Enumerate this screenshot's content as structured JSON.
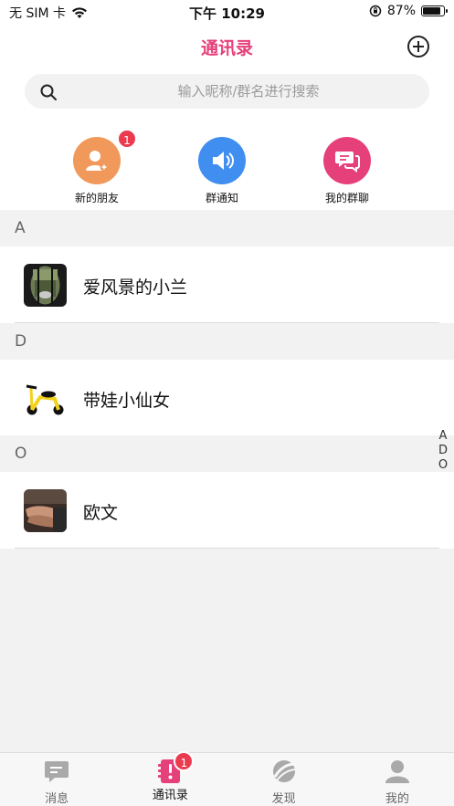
{
  "status_bar": {
    "carrier": "无 SIM 卡",
    "time": "下午 10:29",
    "battery_percent": "87%",
    "battery_level": 0.87
  },
  "header": {
    "title": "通讯录",
    "add_icon": "plus-circle-icon"
  },
  "search": {
    "placeholder": "输入昵称/群名进行搜索",
    "value": ""
  },
  "quick_actions": [
    {
      "label": "新的朋友",
      "icon": "new-friend-icon",
      "color": "#f0995a",
      "badge": "1"
    },
    {
      "label": "群通知",
      "icon": "speaker-icon",
      "color": "#3f8ef0",
      "badge": ""
    },
    {
      "label": "我的群聊",
      "icon": "group-chat-icon",
      "color": "#e6407a",
      "badge": ""
    }
  ],
  "sections": [
    {
      "letter": "A",
      "contacts": [
        {
          "name": "爱风景的小兰",
          "avatar": "landscape-photo"
        }
      ]
    },
    {
      "letter": "D",
      "contacts": [
        {
          "name": "带娃小仙女",
          "avatar": "balance-bike-photo"
        }
      ]
    },
    {
      "letter": "O",
      "contacts": [
        {
          "name": "欧文",
          "avatar": "hands-photo"
        }
      ]
    }
  ],
  "index_letters": [
    "A",
    "D",
    "O"
  ],
  "tabs": [
    {
      "label": "消息",
      "icon": "message-icon",
      "active": false,
      "badge": ""
    },
    {
      "label": "通讯录",
      "icon": "contacts-icon",
      "active": true,
      "badge": "1"
    },
    {
      "label": "发现",
      "icon": "discover-icon",
      "active": false,
      "badge": ""
    },
    {
      "label": "我的",
      "icon": "profile-icon",
      "active": false,
      "badge": ""
    }
  ],
  "colors": {
    "accent": "#e6407a",
    "badge": "#ea3b4f",
    "orange": "#f0995a",
    "blue": "#3f8ef0"
  }
}
